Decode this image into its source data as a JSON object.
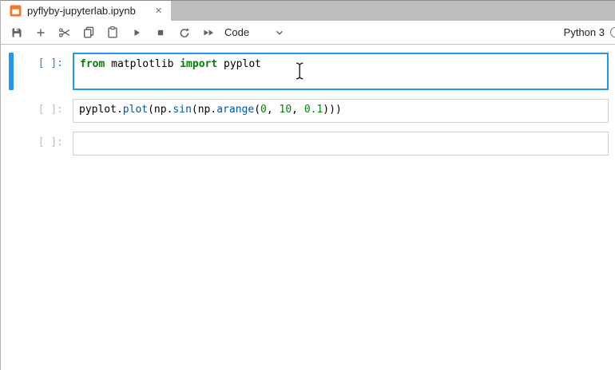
{
  "tab_bar": {
    "tabs": [
      {
        "title": "pyflyby-jupyterlab.ipynb",
        "icon": "notebook-icon",
        "close_glyph": "×",
        "active": true
      }
    ]
  },
  "toolbar": {
    "buttons": [
      {
        "name": "save",
        "icon": "save-icon"
      },
      {
        "name": "insert-cell-below",
        "icon": "plus-icon"
      },
      {
        "name": "cut-cells",
        "icon": "cut-icon"
      },
      {
        "name": "copy-cells",
        "icon": "copy-icon"
      },
      {
        "name": "paste-cells",
        "icon": "paste-icon"
      },
      {
        "name": "run-cell",
        "icon": "run-icon"
      },
      {
        "name": "interrupt-kernel",
        "icon": "stop-icon"
      },
      {
        "name": "restart-kernel",
        "icon": "restart-icon"
      },
      {
        "name": "run-all",
        "icon": "fast-forward-icon"
      }
    ],
    "cell_type_dropdown": {
      "value": "Code"
    },
    "kernel": {
      "name": "Python 3",
      "status": "idle"
    }
  },
  "notebook": {
    "cells": [
      {
        "prompt": "[ ]:",
        "active": true,
        "tokens": [
          {
            "text": "from",
            "type": "keyword"
          },
          {
            "text": " matplotlib ",
            "type": "plain"
          },
          {
            "text": "import",
            "type": "keyword"
          },
          {
            "text": " pyplot",
            "type": "plain"
          }
        ]
      },
      {
        "prompt": "[ ]:",
        "active": false,
        "tokens": [
          {
            "text": "pyplot.",
            "type": "plain"
          },
          {
            "text": "plot",
            "type": "property"
          },
          {
            "text": "(np.",
            "type": "plain"
          },
          {
            "text": "sin",
            "type": "property"
          },
          {
            "text": "(np.",
            "type": "plain"
          },
          {
            "text": "arange",
            "type": "property"
          },
          {
            "text": "(",
            "type": "plain"
          },
          {
            "text": "0",
            "type": "number"
          },
          {
            "text": ", ",
            "type": "plain"
          },
          {
            "text": "10",
            "type": "number"
          },
          {
            "text": ", ",
            "type": "plain"
          },
          {
            "text": "0.1",
            "type": "number"
          },
          {
            "text": ")))",
            "type": "plain"
          }
        ]
      },
      {
        "prompt": "[ ]:",
        "active": false,
        "tokens": []
      }
    ]
  },
  "cursor": {
    "type": "i-beam-text-cursor"
  },
  "colors": {
    "accent": "#2196f3",
    "keyword": "#008000",
    "property": "#0055aa",
    "number": "#008800",
    "active_prompt": "#307fc1",
    "inactive_prompt": "#bdbdbd",
    "jupyter_orange": "#f37726",
    "icon_gray": "#616161"
  }
}
